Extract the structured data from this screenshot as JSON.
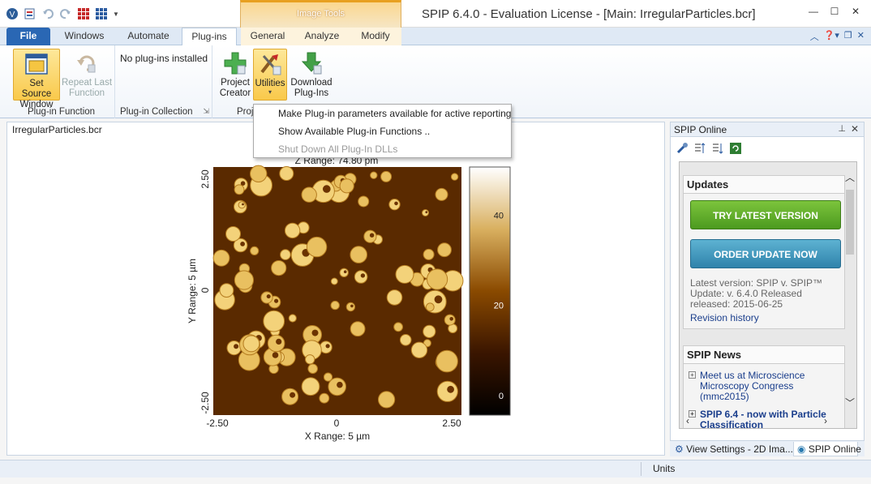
{
  "window": {
    "title": "SPIP 6.4.0 - Evaluation License - [Main: IrregularParticles.bcr]",
    "context_group": "Image Tools"
  },
  "tabs": [
    {
      "label": "File"
    },
    {
      "label": "Windows"
    },
    {
      "label": "Automate"
    },
    {
      "label": "Plug-ins"
    },
    {
      "label": "General"
    },
    {
      "label": "Analyze"
    },
    {
      "label": "Modify"
    }
  ],
  "ribbon": {
    "plugin_function": {
      "group_label": "Plug-in Function",
      "set_source": "Set Source Window",
      "repeat_last": "Repeat Last Function"
    },
    "plugin_collection": {
      "group_label": "Plug-in Collection",
      "empty_text": "No plug-ins installed"
    },
    "project": {
      "group_label": "Proj",
      "project_creator": "Project Creator",
      "utilities": "Utilities",
      "download": "Download Plug-Ins"
    }
  },
  "menu": {
    "items": [
      {
        "label": "Make Plug-in parameters available for active reporting",
        "enabled": true
      },
      {
        "label": "Show Available Plug-in Functions ..",
        "enabled": true
      },
      {
        "label": "Shut Down All Plug-In DLLs",
        "enabled": false
      }
    ]
  },
  "document": {
    "name": "IrregularParticles.bcr",
    "z_range": "Z Range:  74.80 pm",
    "x_label": "X Range: 5 µm",
    "y_label": "Y Range: 5 µm",
    "x_ticks": [
      "-2.50",
      "0",
      "2.50"
    ],
    "y_ticks": [
      "2.50",
      "0",
      "-2.50"
    ],
    "color_ticks": [
      "40",
      "20",
      "0"
    ],
    "colorbar_values": [
      40,
      20,
      0
    ]
  },
  "panel": {
    "title": "SPIP Online",
    "updates": {
      "heading": "Updates",
      "try_button": "TRY LATEST VERSION",
      "order_button": "ORDER UPDATE NOW",
      "info_lines": [
        "Latest version: SPIP v. SPIP™",
        "Update: v. 6.4.0 Released",
        "released: 2015-06-25"
      ],
      "revision_link": "Revision history"
    },
    "news": {
      "heading": "SPIP News",
      "items": [
        {
          "text": "Meet us at Microscience Microscopy Congress (mmc2015)"
        },
        {
          "text": "SPIP 6.4 - now with Particle Classification"
        }
      ]
    },
    "bottom_tabs": [
      {
        "label": "View Settings - 2D Ima..."
      },
      {
        "label": "SPIP Online"
      }
    ]
  },
  "status": {
    "units_label": "Units"
  },
  "colors": {
    "file_tab": "#2a67b4",
    "highlight": "#f9c94b",
    "green_button": "#5aa62a",
    "blue_button": "#3a8fb7"
  }
}
